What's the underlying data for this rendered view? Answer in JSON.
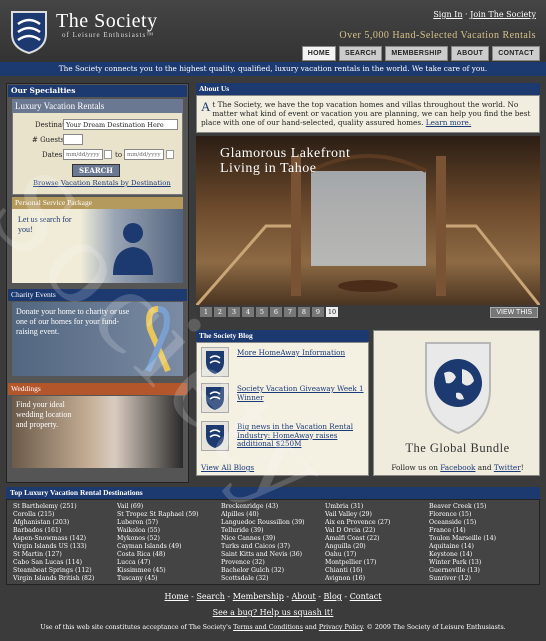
{
  "header": {
    "logo_title": "The Society",
    "logo_sub": "of Leisure Enthusiasts™",
    "signin": "Sign In",
    "join": "Join The Society",
    "tagline": "Over 5,000 Hand-Selected Vacation Rentals",
    "nav": [
      "HOME",
      "SEARCH",
      "MEMBERSHIP",
      "ABOUT",
      "CONTACT"
    ]
  },
  "bluebar": "The Society connects you to the highest quality, qualified, luxury vacation rentals in the world. We take care of you.",
  "specialties": {
    "title": "Our Specialties",
    "lux_title": "Luxury Vacation Rentals",
    "dest_label": "Destination:",
    "dest_value": "Your Dream Destination Here",
    "guests_label": "# Guests:",
    "dates_label": "Dates:",
    "date_placeholder": "mm/dd/yyyy",
    "to": "to",
    "search_btn": "SEARCH",
    "browse": "Browse Vacation Rentals by Destination",
    "pers_title": "Personal Service Package",
    "pers_text": "Let us search for you!",
    "char_title": "Charity Events",
    "char_text": "Donate your home to charity or use one of our homes for your fund-raising event.",
    "wed_title": "Weddings",
    "wed_text": "Find your ideal wedding location and property."
  },
  "about": {
    "title": "About Us",
    "dropcap": "A",
    "text": "t The Society, we have the top vacation homes and villas throughout the world. No matter what kind of event or vacation you are planning, we can help you find the best place with one of our hand-selected, quality assured homes.",
    "learn": "Learn more."
  },
  "hero": {
    "title": "Glamorous Lakefront Living in Tahoe",
    "pages": [
      "1",
      "2",
      "3",
      "4",
      "5",
      "6",
      "7",
      "8",
      "9",
      "10"
    ],
    "view": "VIEW THIS"
  },
  "blog": {
    "title": "The Society Blog",
    "items": [
      "More HomeAway Information",
      "Society Vacation Giveaway Week 1 Winner",
      "Big news in the Vacation Rental Industry: HomeAway raises additional $250M"
    ],
    "all": "View All Blogs"
  },
  "global": {
    "title": "The Global Bundle",
    "follow_pre": "Follow us on",
    "facebook": "Facebook",
    "and": "and",
    "twitter": "Twitter",
    "bang": "!"
  },
  "destinations": {
    "title": "Top Luxury Vacation Rental Destinations",
    "cols": [
      [
        "St Barthelemy (251)",
        "Corolla (215)",
        "Afghanistan (203)",
        "Barbados (161)",
        "Aspen-Snowmass (142)",
        "Virgin Islands US (133)",
        "St Martin (127)",
        "Cabo San Lucas (114)",
        "Steamboat Springs (112)",
        "Virgin Islands British (82)"
      ],
      [
        "Vail (69)",
        "St Tropez St Raphael (59)",
        "Luberon (57)",
        "Waikoloa (55)",
        "Mykonos (52)",
        "Cayman Islands (49)",
        "Costa Rica (48)",
        "Lucca (47)",
        "Kissimmee (45)",
        "Tuscany (45)"
      ],
      [
        "Breckenridge (43)",
        "Alpilles (40)",
        "Languedoc Roussillon (39)",
        "Telluride (39)",
        "Nice Cannes (39)",
        "Turks and Caicos (37)",
        "Saint Kitts and Nevis (36)",
        "Provence (32)",
        "Bachelor Gulch (32)",
        "Scottsdale (32)"
      ],
      [
        "Umbria (31)",
        "Vail Valley (29)",
        "Aix en Provence (27)",
        "Val D Orcia (22)",
        "Amalfi Coast (22)",
        "Anguilla (20)",
        "Oahu (17)",
        "Montpellier (17)",
        "Chianti (16)",
        "Avignon (16)"
      ],
      [
        "Beaver Creek (15)",
        "Florence (15)",
        "Oceanside (15)",
        "France (14)",
        "Toulon Marseille (14)",
        "Aquitaine (14)",
        "Keystone (14)",
        "Winter Park (13)",
        "Guerneville (13)",
        "Sunriver (12)"
      ]
    ]
  },
  "footer": {
    "nav": [
      "Home",
      "Search",
      "Membership",
      "About",
      "Blog",
      "Contact"
    ],
    "bug": "See a bug? Help us squash it!",
    "legal_pre": "Use of this web site constitutes acceptance of The Society's",
    "terms": "Terms and Conditions",
    "and": "and",
    "privacy": "Privacy Policy",
    "legal_post": ". © 2009 The Society of Leisure Enthusiasts."
  },
  "watermark": "Society"
}
